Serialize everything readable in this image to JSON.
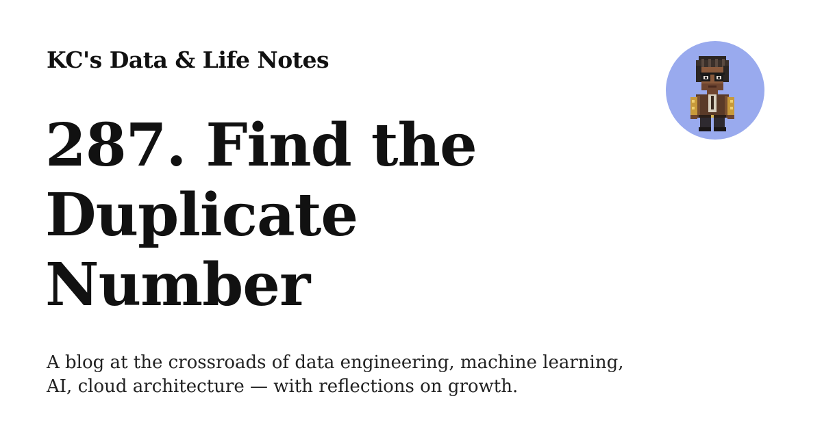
{
  "site": {
    "name": "KC's Data & Life Notes"
  },
  "post": {
    "title": "287. Find the Duplicate Number"
  },
  "blog": {
    "description": "A blog at the crossroads of data engineering, machine learning, AI, cloud architecture — with reflections on growth."
  },
  "avatar": {
    "icon": "pixel-art-person-with-glasses-icon",
    "background_color": "#99aaee"
  }
}
